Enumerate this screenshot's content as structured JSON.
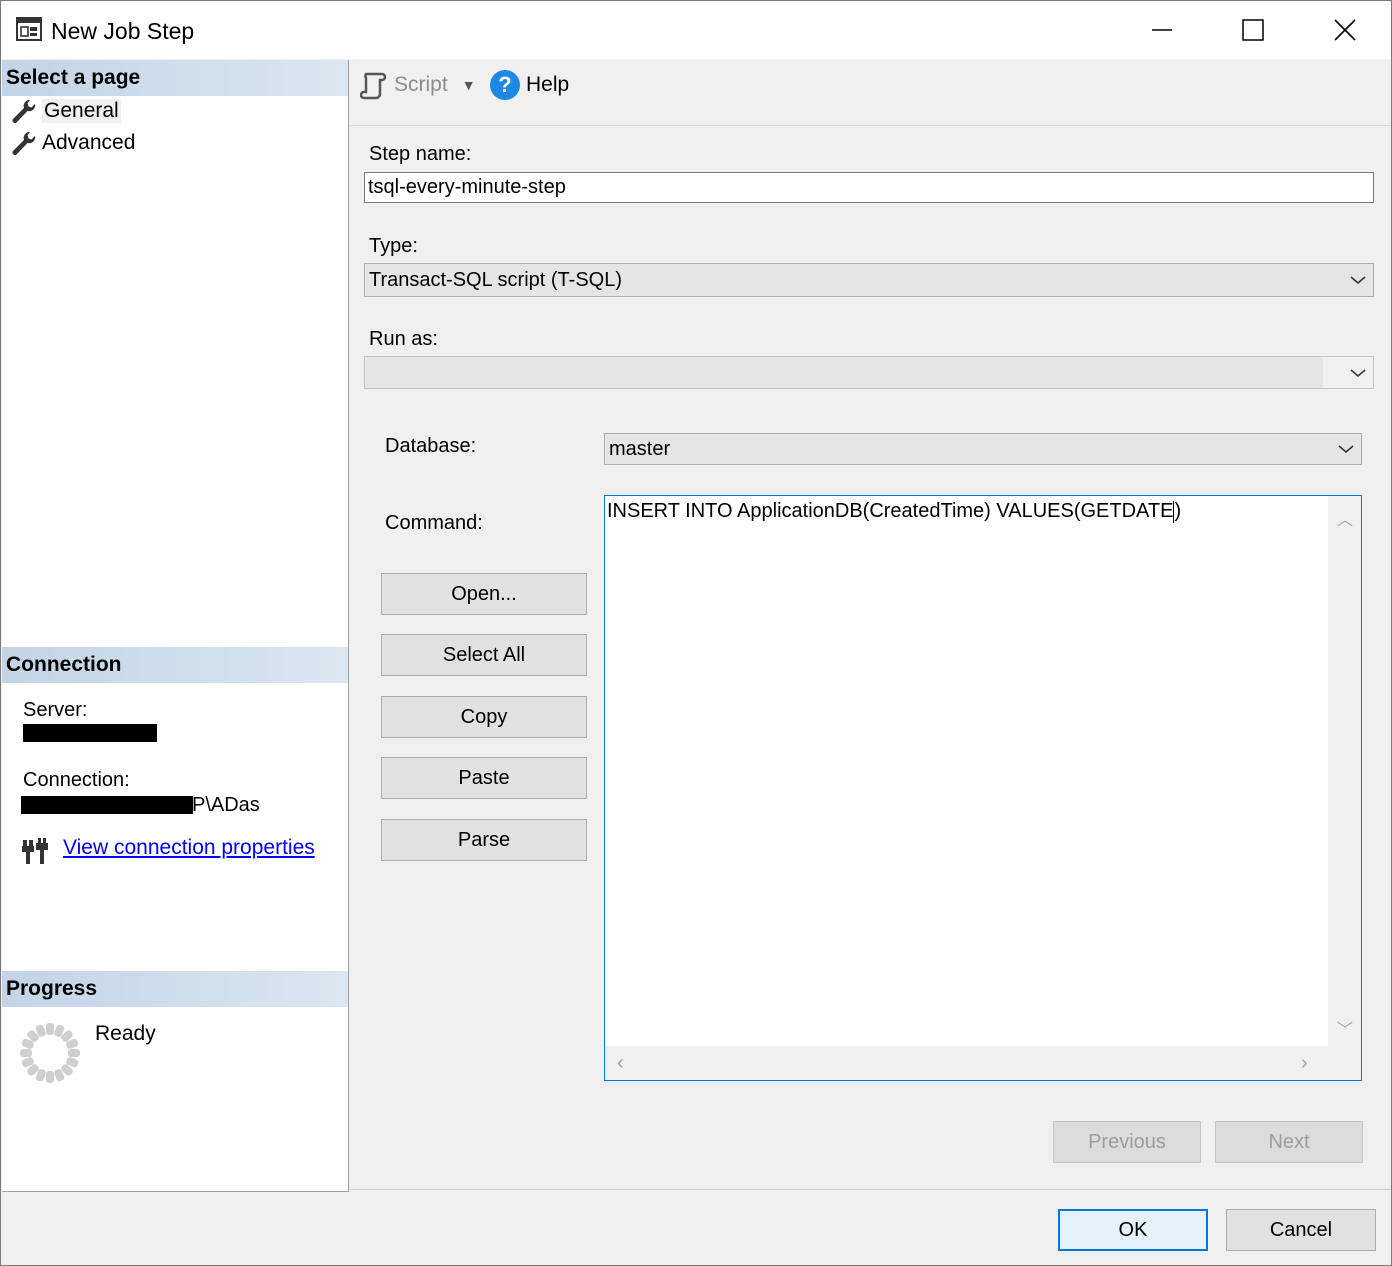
{
  "window": {
    "title": "New Job Step"
  },
  "left": {
    "select_page_header": "Select a page",
    "pages": [
      {
        "label": "General",
        "selected": true
      },
      {
        "label": "Advanced",
        "selected": false
      }
    ],
    "connection_header": "Connection",
    "server_label": "Server:",
    "connection_label": "Connection:",
    "connection_suffix": "P\\ADas",
    "view_connection_link": "View connection properties",
    "progress_header": "Progress",
    "progress_status": "Ready"
  },
  "toolbar": {
    "script_label": "Script",
    "help_label": "Help",
    "help_glyph": "?"
  },
  "form": {
    "step_name_label": "Step name:",
    "step_name_value": "tsql-every-minute-step",
    "type_label": "Type:",
    "type_value": "Transact-SQL script (T-SQL)",
    "run_as_label": "Run as:",
    "run_as_value": "",
    "database_label": "Database:",
    "database_value": "master",
    "command_label": "Command:",
    "command_before_caret": "INSERT INTO ApplicationDB(CreatedTime) VALUES(GETDATE",
    "command_after_caret": ")",
    "open_button": "Open...",
    "select_all_button": "Select All",
    "copy_button": "Copy",
    "paste_button": "Paste",
    "parse_button": "Parse"
  },
  "nav_buttons": {
    "previous": "Previous",
    "next": "Next"
  },
  "dialog_buttons": {
    "ok": "OK",
    "cancel": "Cancel"
  },
  "colors": {
    "accent": "#0078d7",
    "link": "#0000ff",
    "section_header": "#c3d4e6",
    "help_icon": "#1e88e5"
  }
}
